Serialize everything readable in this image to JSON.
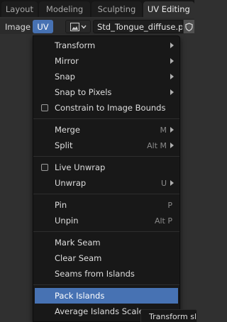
{
  "workspace_tabs": [
    {
      "label": "Layout",
      "active": false
    },
    {
      "label": "Modeling",
      "active": false
    },
    {
      "label": "Sculpting",
      "active": false
    },
    {
      "label": "UV Editing",
      "active": true
    }
  ],
  "header": {
    "image_menu": "Image",
    "uv_menu": "UV",
    "image_browse_icon": "image-icon",
    "image_name": "Std_Tongue_diffuse.png",
    "fake_user_icon": "shield-icon"
  },
  "menu": {
    "groups": [
      [
        {
          "label": "Transform",
          "submenu": true
        },
        {
          "label": "Mirror",
          "submenu": true
        },
        {
          "label": "Snap",
          "submenu": true
        },
        {
          "label": "Snap to Pixels",
          "submenu": true
        },
        {
          "label": "Constrain to Image Bounds",
          "checkbox": true
        }
      ],
      [
        {
          "label": "Merge",
          "shortcut": "M",
          "submenu": true
        },
        {
          "label": "Split",
          "shortcut": "Alt M",
          "submenu": true
        }
      ],
      [
        {
          "label": "Live Unwrap",
          "checkbox": true
        },
        {
          "label": "Unwrap",
          "shortcut": "U",
          "submenu": true
        }
      ],
      [
        {
          "label": "Pin",
          "shortcut": "P"
        },
        {
          "label": "Unpin",
          "shortcut": "Alt P"
        }
      ],
      [
        {
          "label": "Mark Seam"
        },
        {
          "label": "Clear Seam"
        },
        {
          "label": "Seams from Islands"
        }
      ],
      [
        {
          "label": "Pack Islands",
          "active": true
        },
        {
          "label": "Average Islands Scale"
        }
      ]
    ]
  },
  "tooltip": "Transform sl",
  "colors": {
    "accent": "#4772b3",
    "menu_bg": "#181818"
  }
}
